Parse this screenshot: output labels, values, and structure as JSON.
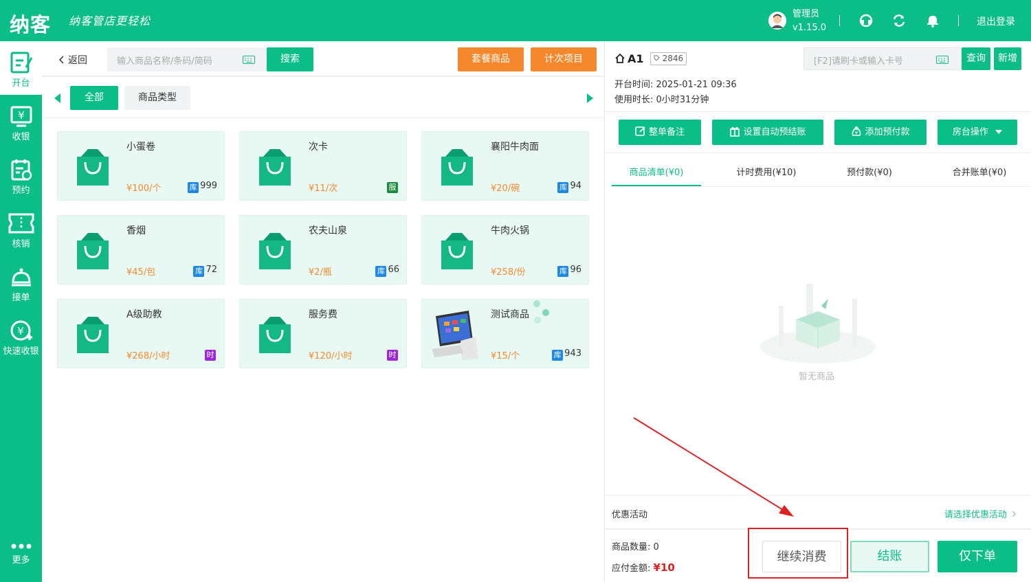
{
  "header": {
    "logo": "纳客",
    "slogan": "纳客管店更轻松",
    "user_name": "管理员",
    "version": "v1.15.0",
    "logout": "退出登录"
  },
  "sidebar": {
    "items": [
      {
        "label": "开台",
        "icon": "open-table-icon"
      },
      {
        "label": "收银",
        "icon": "cashier-icon"
      },
      {
        "label": "预约",
        "icon": "reservation-icon"
      },
      {
        "label": "核销",
        "icon": "ticket-icon"
      },
      {
        "label": "接单",
        "icon": "service-bell-icon"
      },
      {
        "label": "快速收银",
        "icon": "quick-cashier-icon"
      }
    ],
    "more": "更多"
  },
  "left": {
    "back": "返回",
    "search_placeholder": "输入商品名称/条码/简码",
    "search_btn": "搜索",
    "package_btn": "套餐商品",
    "count_btn": "计次项目",
    "cat_all": "全部",
    "cat_type": "商品类型",
    "products": [
      {
        "name": "小蛋卷",
        "price": "¥100/个",
        "tag": "库",
        "tag_color": "#1e88e5",
        "stock": "999"
      },
      {
        "name": "次卡",
        "price": "¥11/次",
        "tag": "服",
        "tag_color": "#1b8a3a",
        "stock": ""
      },
      {
        "name": "襄阳牛肉面",
        "price": "¥20/碗",
        "tag": "库",
        "tag_color": "#1e88e5",
        "stock": "94"
      },
      {
        "name": "香烟",
        "price": "¥45/包",
        "tag": "库",
        "tag_color": "#1e88e5",
        "stock": "72"
      },
      {
        "name": "农夫山泉",
        "price": "¥2/瓶",
        "tag": "库",
        "tag_color": "#1e88e5",
        "stock": "66"
      },
      {
        "name": "牛肉火锅",
        "price": "¥258/份",
        "tag": "库",
        "tag_color": "#1e88e5",
        "stock": "96"
      },
      {
        "name": "A级助教",
        "price": "¥268/小时",
        "tag": "时",
        "tag_color": "#9c27d8",
        "stock": ""
      },
      {
        "name": "服务费",
        "price": "¥120/小时",
        "tag": "时",
        "tag_color": "#9c27d8",
        "stock": ""
      },
      {
        "name": "测试商品",
        "price": "¥15/个",
        "tag": "库",
        "tag_color": "#1e88e5",
        "stock": "943"
      }
    ]
  },
  "right": {
    "table_name": "A1",
    "table_code": "2846",
    "card_placeholder": "[F2]请刷卡或输入卡号",
    "query_btn": "查询",
    "add_btn": "新增",
    "open_time": "开台时间: 2025-01-21 09:36",
    "duration": "使用时长: 0小时31分钟",
    "actions": [
      "整单备注",
      "设置自动预结账",
      "添加预付款",
      "房台操作"
    ],
    "tabs": [
      "商品清单(¥0)",
      "计时费用(¥10)",
      "预付款(¥0)",
      "合并账单(¥0)"
    ],
    "empty_text": "暂无商品",
    "promo_label": "优惠活动",
    "promo_link": "请选择优惠活动",
    "qty": "商品数量: 0",
    "amount_label": "应付金额:",
    "amount_value": "¥10",
    "btn_continue": "继续消费",
    "btn_pay": "结账",
    "btn_order": "仅下单"
  },
  "colors": {
    "primary": "#0bbd87",
    "orange": "#f5882d",
    "annotation": "#e02020"
  }
}
